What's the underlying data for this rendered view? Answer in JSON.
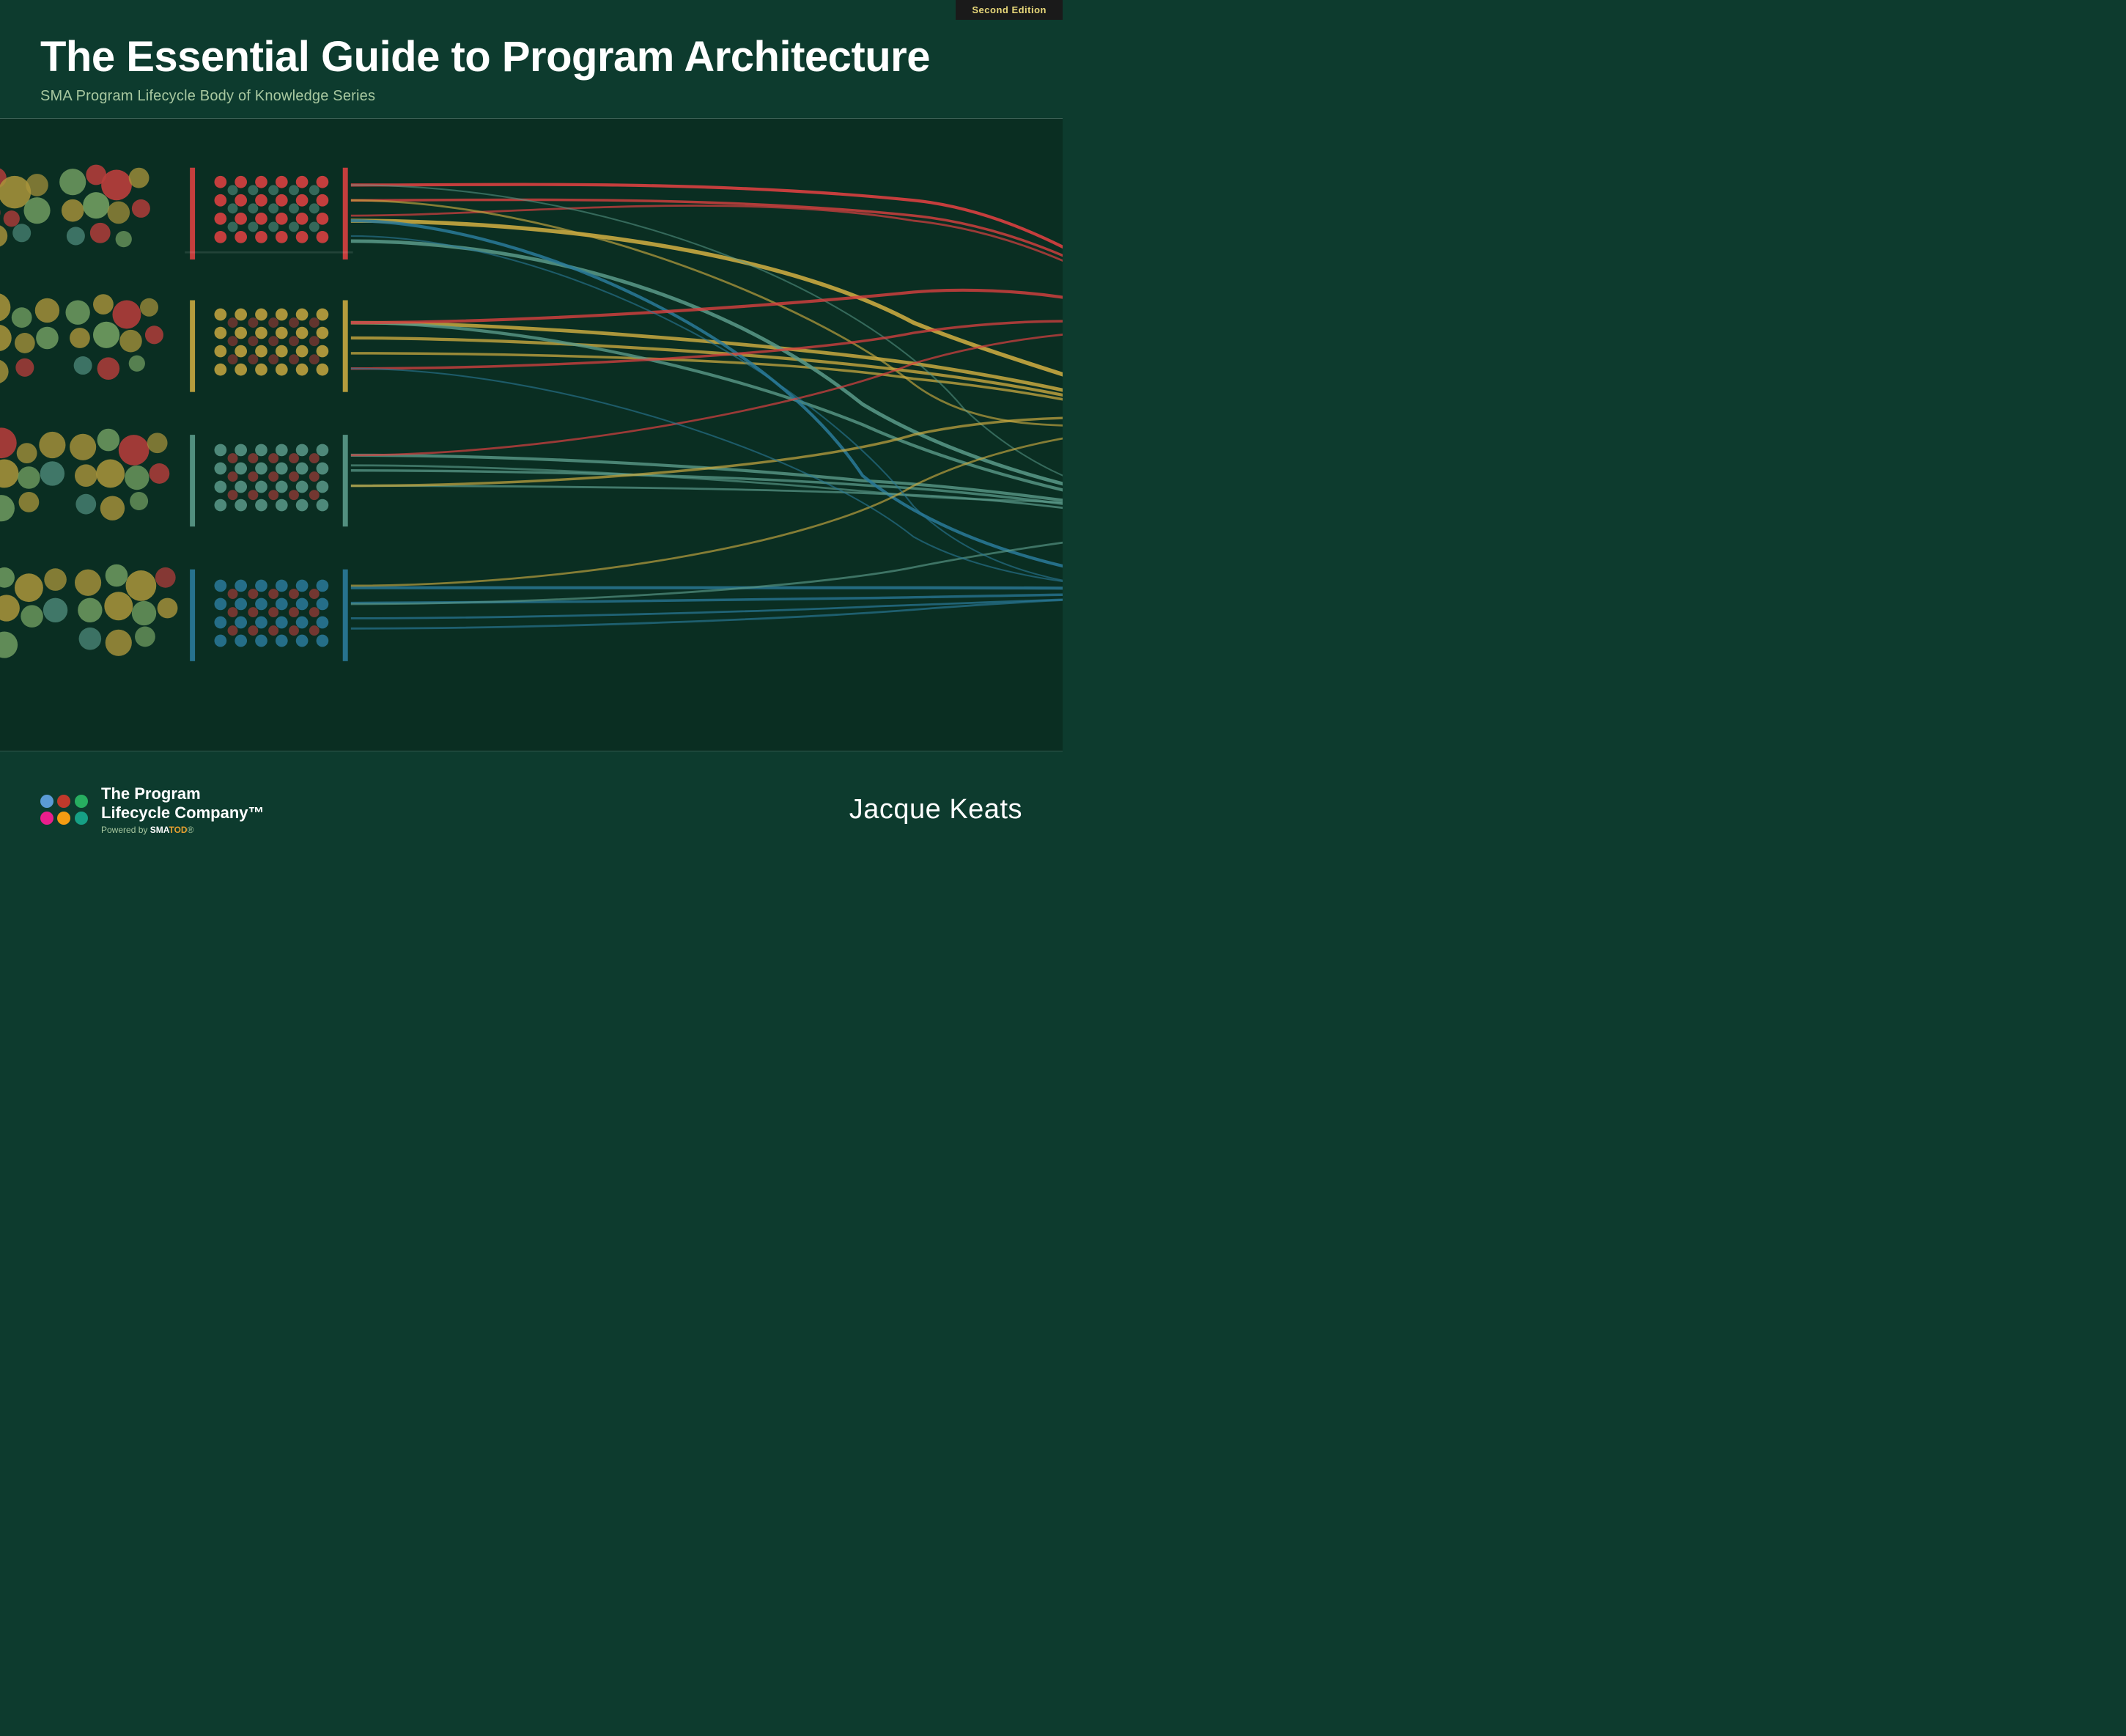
{
  "header": {
    "edition_badge": "Second Edition",
    "title": "The Essential Guide to Program Architecture",
    "subtitle": "SMA Program Lifecycle Body of Knowledge Series"
  },
  "footer": {
    "company_name_line1": "The Program",
    "company_name_line2": "Lifecycle Company™",
    "powered_prefix": "Powered by ",
    "powered_sma": "SMA",
    "powered_tod": "TOD",
    "powered_suffix": "®",
    "author": "Jacque Keats"
  },
  "logo_dots": [
    {
      "color": "#5b9bd5"
    },
    {
      "color": "#c0392b"
    },
    {
      "color": "#27ae60"
    },
    {
      "color": "#e91e8c"
    },
    {
      "color": "#f39c12"
    },
    {
      "color": "#16a085"
    }
  ],
  "viz": {
    "bg_color": "#0a2e22",
    "accent_colors": {
      "red": "#d94040",
      "yellow": "#d4cf6a",
      "teal": "#5a9a8a",
      "blue": "#2a7a9a"
    }
  }
}
